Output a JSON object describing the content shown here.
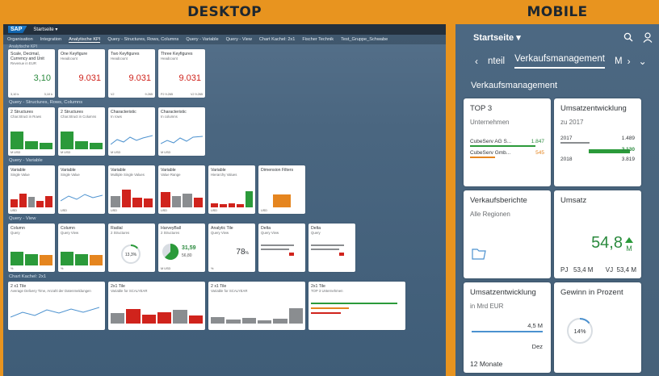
{
  "headers": {
    "desktop": "DESKTOP",
    "mobile": "MOBILE"
  },
  "desktop": {
    "shell_title": "Startseite ▾",
    "logo": "SAP",
    "tabs": [
      "Organisation",
      "Integration",
      "Analytische KPI",
      "Query - Structures, Rows, Columns",
      "Query - Variable",
      "Query - View",
      "Chart Kachel: 2x1",
      "Fischer Technik",
      "Test_Gruppe_Schwabe"
    ],
    "active_tab": "Analytische KPI",
    "cut_section": "Analytische KPI",
    "kpi_tiles": [
      {
        "title": "Scale, Decimal, Currency and Unit",
        "sub": "Revenue in EUR",
        "value": "3,10",
        "foot_left": "3,10 k",
        "foot_right": "3,10 k"
      },
      {
        "title": "One Keyfigure",
        "sub": "Headcount",
        "value": "9.031",
        "foot_left": "",
        "foot_right": ""
      },
      {
        "title": "Two Keyfigures",
        "sub": "Headcount",
        "value": "9.031",
        "foot_left": "VJ",
        "foot_right": "9.265"
      },
      {
        "title": "Three Keyfigures",
        "sub": "Headcount",
        "value": "9.031",
        "foot_left": "PJ 9.265",
        "foot_right": "VJ 9.265"
      }
    ],
    "section_structures": "Query - Structures, Rows, Columns",
    "structure_tiles": [
      {
        "title": "2 Structures",
        "sub": "Char.Struct in Rows",
        "foot": "M USD"
      },
      {
        "title": "2 Structures",
        "sub": "Char.Struct in Columns",
        "foot": "M USD"
      },
      {
        "title": "Characteristic",
        "sub": "In rows",
        "foot": "M USD"
      },
      {
        "title": "Characteristic",
        "sub": "In columns",
        "foot": "M USD"
      }
    ],
    "section_variable": "Query - Variable",
    "variable_tiles": [
      {
        "title": "Variable",
        "sub": "Single Value",
        "foot": "USD"
      },
      {
        "title": "Variable",
        "sub": "Single Value",
        "foot": "USD"
      },
      {
        "title": "Variable",
        "sub": "Multiple Single Values",
        "foot": "USD"
      },
      {
        "title": "Variable",
        "sub": "Value Range",
        "foot": "USD"
      },
      {
        "title": "Variable",
        "sub": "Hierarchy Values",
        "foot": "USD"
      },
      {
        "title": "Dimension Filters",
        "sub": "",
        "foot": "USD"
      }
    ],
    "section_view": "Query - View",
    "view_tiles": [
      {
        "title": "Column",
        "sub": "Query",
        "foot": "%"
      },
      {
        "title": "Column",
        "sub": "Query View",
        "foot": "%"
      },
      {
        "title": "Radial",
        "sub": "2 Structures",
        "foot": "",
        "value": "13,3%"
      },
      {
        "title": "HarveyBall",
        "sub": "2 Structures",
        "foot": "M USD",
        "value": "31,59",
        "value2": "56,80"
      },
      {
        "title": "Analytic Tile",
        "sub": "Query View",
        "foot": "%",
        "value": "78",
        "unit": "%"
      },
      {
        "title": "Delta",
        "sub": "Query View",
        "foot": ""
      },
      {
        "title": "Delta",
        "sub": "Query",
        "foot": ""
      }
    ],
    "section_chart": "Chart Kachel: 2x1",
    "chart_tiles": [
      {
        "title": "2 x1 Tile",
        "sub": "Average Delivery Time, Anzahl der Datenmeldungen"
      },
      {
        "title": "2x1 Tile",
        "sub": "Variable for SCALYEAR"
      },
      {
        "title": "2 x1 Tile",
        "sub": "Variable for SCALYEAR"
      },
      {
        "title": "2x1 Tile",
        "sub": "TOP 3 Unternehmen"
      }
    ],
    "colors": {
      "green": "#2b9a3a",
      "red": "#d0231c",
      "orange": "#e5851f",
      "grey": "#8a8d90",
      "blue": "#4b91cf"
    }
  },
  "mobile": {
    "title": "Startseite ▾",
    "icons": [
      "search-icon",
      "person-icon"
    ],
    "tabs": {
      "back": "‹",
      "prev": "nteil",
      "active": "Verkaufsmanagement",
      "next": "M",
      "forward": "›",
      "menu": "⌄"
    },
    "page_title": "Verkaufsmanagement",
    "top3": {
      "title": "TOP 3",
      "sub": "Unternehmen",
      "rows": [
        {
          "label": "CubeServ AG S...",
          "value": "1.847"
        },
        {
          "label": "CubeServ Gmb...",
          "value": "545"
        }
      ]
    },
    "umsatzentwicklung": {
      "title": "Umsatzentwicklung",
      "sub": "zu 2017",
      "rows": [
        {
          "label": "2017",
          "value": "1.489"
        },
        {
          "label": "",
          "value": "2.130"
        },
        {
          "label": "2018",
          "value": "3.819"
        }
      ]
    },
    "verkaufsberichte": {
      "title": "Verkaufsberichte",
      "sub": "Alle Regionen"
    },
    "umsatz": {
      "title": "Umsatz",
      "value": "54,8",
      "unit": "M",
      "pj_label": "PJ",
      "pj": "53,4 M",
      "vj_label": "VJ",
      "vj": "53,4 M"
    },
    "umsatzentwicklung2": {
      "title": "Umsatzentwicklung",
      "sub": "in Mrd EUR",
      "value": "4,5 M",
      "axis": "Dez",
      "foot": "12 Monate"
    },
    "gewinn": {
      "title": "Gewinn in Prozent",
      "value": "14%",
      "progress": 0.14
    }
  }
}
